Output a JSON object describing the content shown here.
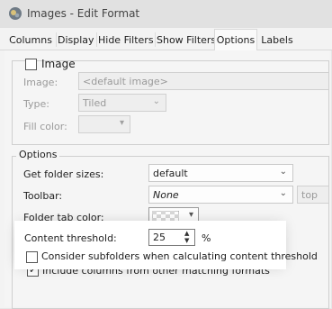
{
  "window": {
    "title": "Images - Edit Format"
  },
  "tabs": [
    "Columns",
    "Display",
    "Hide Filters",
    "Show Filters",
    "Options",
    "Labels"
  ],
  "active_tab": "Options",
  "image_group": {
    "checkbox_label": "Image",
    "image_label": "Image:",
    "image_value": "<default image>",
    "type_label": "Type:",
    "type_value": "Tiled",
    "fill_color_label": "Fill color:"
  },
  "options_group": {
    "title": "Options",
    "folder_sizes_label": "Get folder sizes:",
    "folder_sizes_value": "default",
    "toolbar_label": "Toolbar:",
    "toolbar_value": "None",
    "toolbar_position_value": "top",
    "folder_tab_color_label": "Folder tab color:",
    "content_threshold_label": "Content threshold:",
    "content_threshold_value": "25",
    "content_threshold_unit": "%",
    "consider_subfolders_label": "Consider subfolders when calculating content threshold",
    "consider_subfolders_checked": false,
    "include_columns_label": "Include columns from other matching formats",
    "include_columns_checked": true
  },
  "colors": {
    "titlebar": "#e1e1e1",
    "window_bg": "#f3f3f3"
  }
}
